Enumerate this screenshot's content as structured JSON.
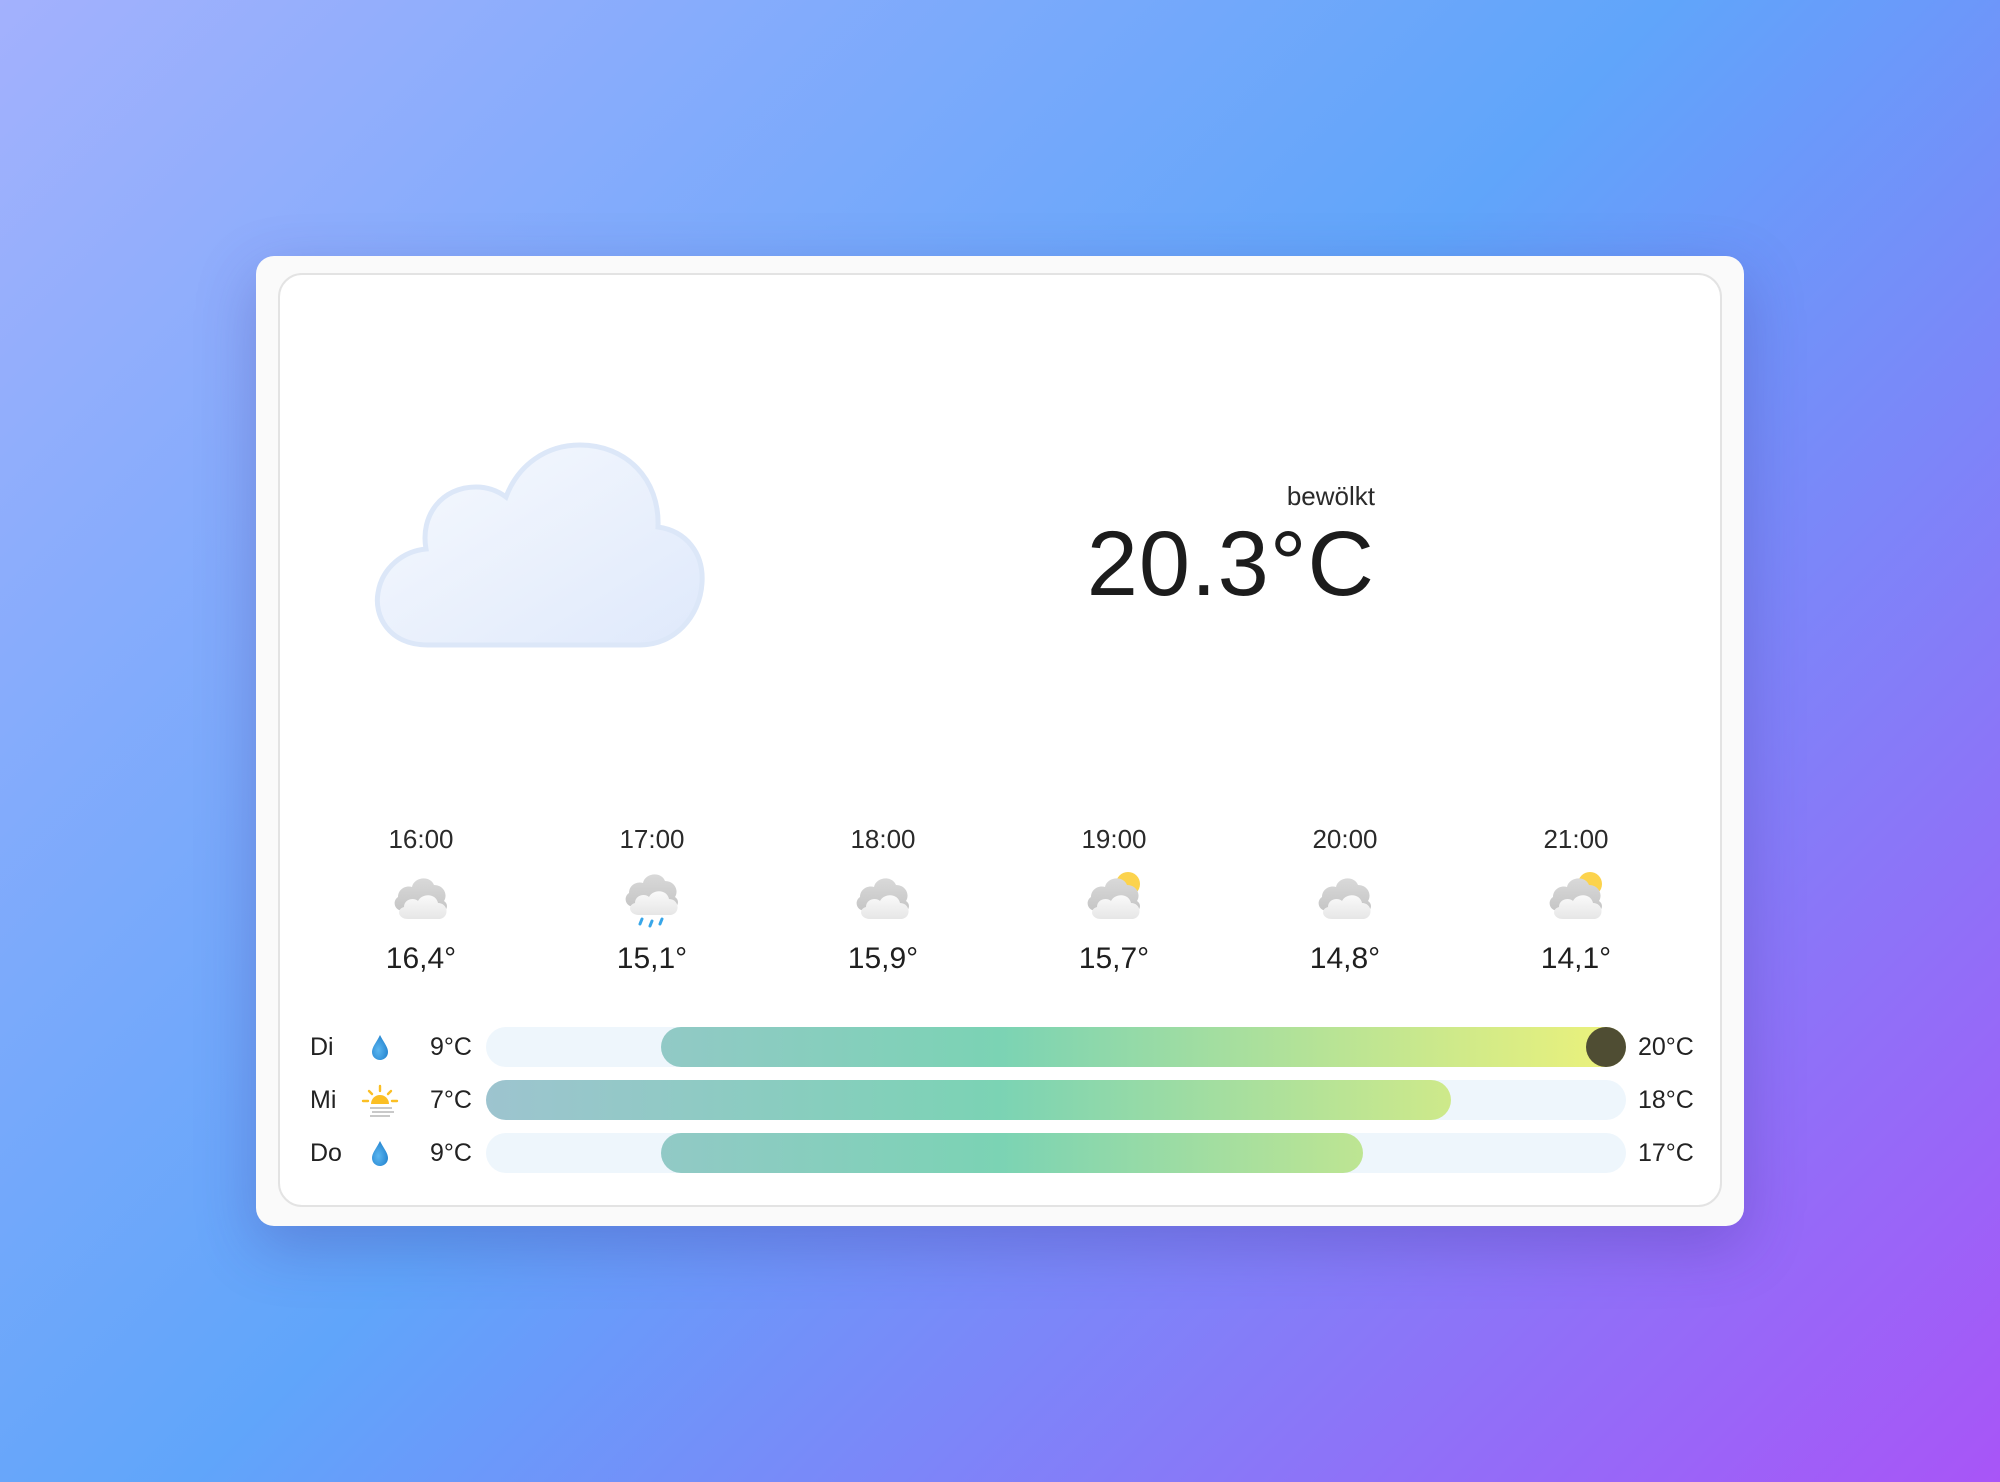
{
  "current": {
    "condition": "bewölkt",
    "temperature": "20.3°C",
    "icon": "cloudy-icon"
  },
  "hourly": [
    {
      "time": "16:00",
      "icon": "cloudy-icon",
      "temp": "16,4°"
    },
    {
      "time": "17:00",
      "icon": "rain-icon",
      "temp": "15,1°"
    },
    {
      "time": "18:00",
      "icon": "cloudy-icon",
      "temp": "15,9°"
    },
    {
      "time": "19:00",
      "icon": "partly-cloudy-icon",
      "temp": "15,7°"
    },
    {
      "time": "20:00",
      "icon": "cloudy-icon",
      "temp": "14,8°"
    },
    {
      "time": "21:00",
      "icon": "partly-cloudy-icon",
      "temp": "14,1°"
    }
  ],
  "daily_scale": {
    "min": 7,
    "max": 20
  },
  "daily": [
    {
      "day": "Di",
      "icon": "rain-drop-icon",
      "low_label": "9°C",
      "high_label": "20°C",
      "low": 9,
      "high": 20,
      "current_marker": 20
    },
    {
      "day": "Mi",
      "icon": "sunrise-fog-icon",
      "low_label": "7°C",
      "high_label": "18°C",
      "low": 7,
      "high": 18
    },
    {
      "day": "Do",
      "icon": "rain-drop-icon",
      "low_label": "9°C",
      "high_label": "17°C",
      "low": 9,
      "high": 17
    }
  ],
  "colors": {
    "bar_track": "#eef6fc",
    "cool": "#9dc4cf",
    "mid": "#7bd3b4",
    "warm": "#eef27a",
    "current_marker": "#4f4d33",
    "sun": "#fcd34d",
    "rain": "#38a6e8",
    "drop": "#2b8fd6"
  }
}
